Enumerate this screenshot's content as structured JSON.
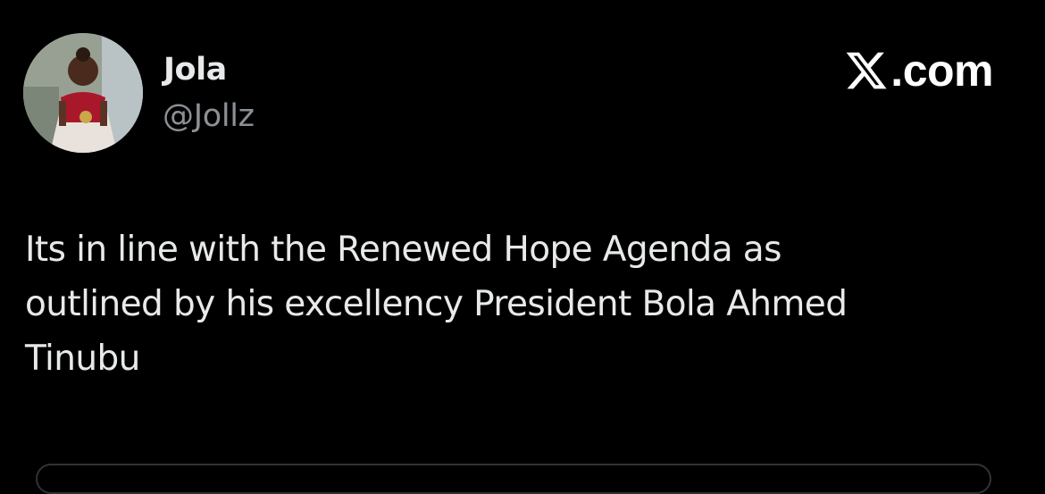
{
  "author": {
    "display_name": "Jola",
    "handle": "@Jollz",
    "avatar_icon": "profile-photo"
  },
  "brand": {
    "icon": "x-logo-icon",
    "domain": ".com"
  },
  "tweet": {
    "text": "Its in line with the Renewed Hope Agenda as\noutlined by his excellency President Bola Ahmed\nTinubu"
  },
  "colors": {
    "background": "#000000",
    "primary_text": "#e7e9ea",
    "secondary_text": "#8b9096",
    "border": "#2f3336"
  }
}
